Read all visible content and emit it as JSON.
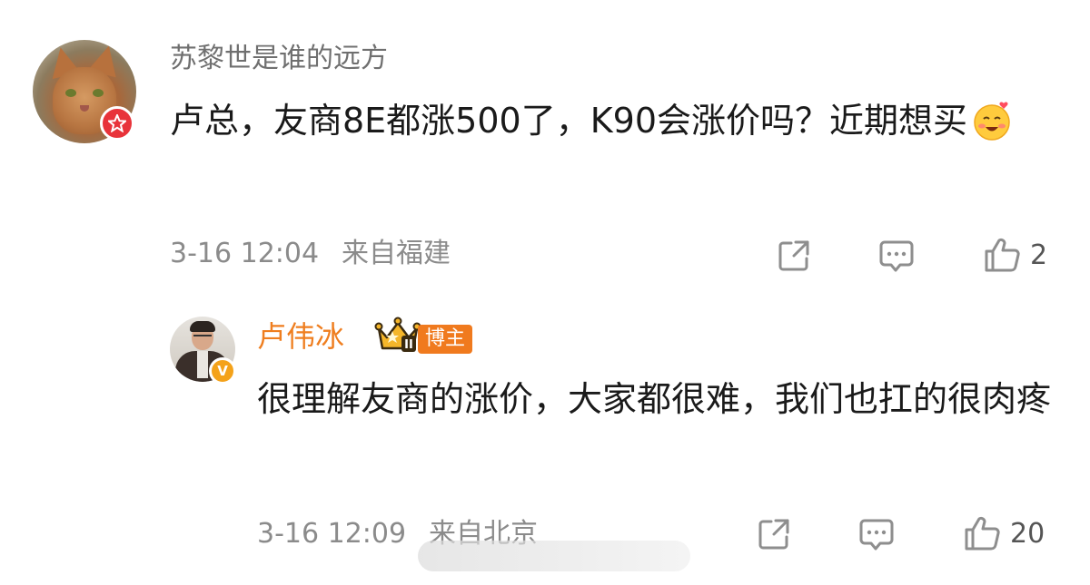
{
  "comment": {
    "username": "苏黎世是谁的远方",
    "text": "卢总，友商8E都涨500了，K90会涨价吗？近期想买",
    "date": "3-16 12:04",
    "location": "来自福建",
    "like_count": "2"
  },
  "reply": {
    "username": "卢伟冰",
    "role_tag": "博主",
    "level": "II",
    "verified_mark": "V",
    "text": "很理解友商的涨价，大家都很难，我们也扛的很肉疼",
    "date": "3-16 12:09",
    "location": "来自北京",
    "like_count": "20"
  },
  "colors": {
    "username_gray": "#6f6f6f",
    "author_orange": "#ef7e1f",
    "verified_red": "#e8333a",
    "verified_gold": "#f4a21a",
    "meta_gray": "#8b8b8b"
  },
  "icons": [
    "share-icon",
    "comment-icon",
    "thumbs-up-icon",
    "crown-icon",
    "smiling-hearts-emoji"
  ]
}
